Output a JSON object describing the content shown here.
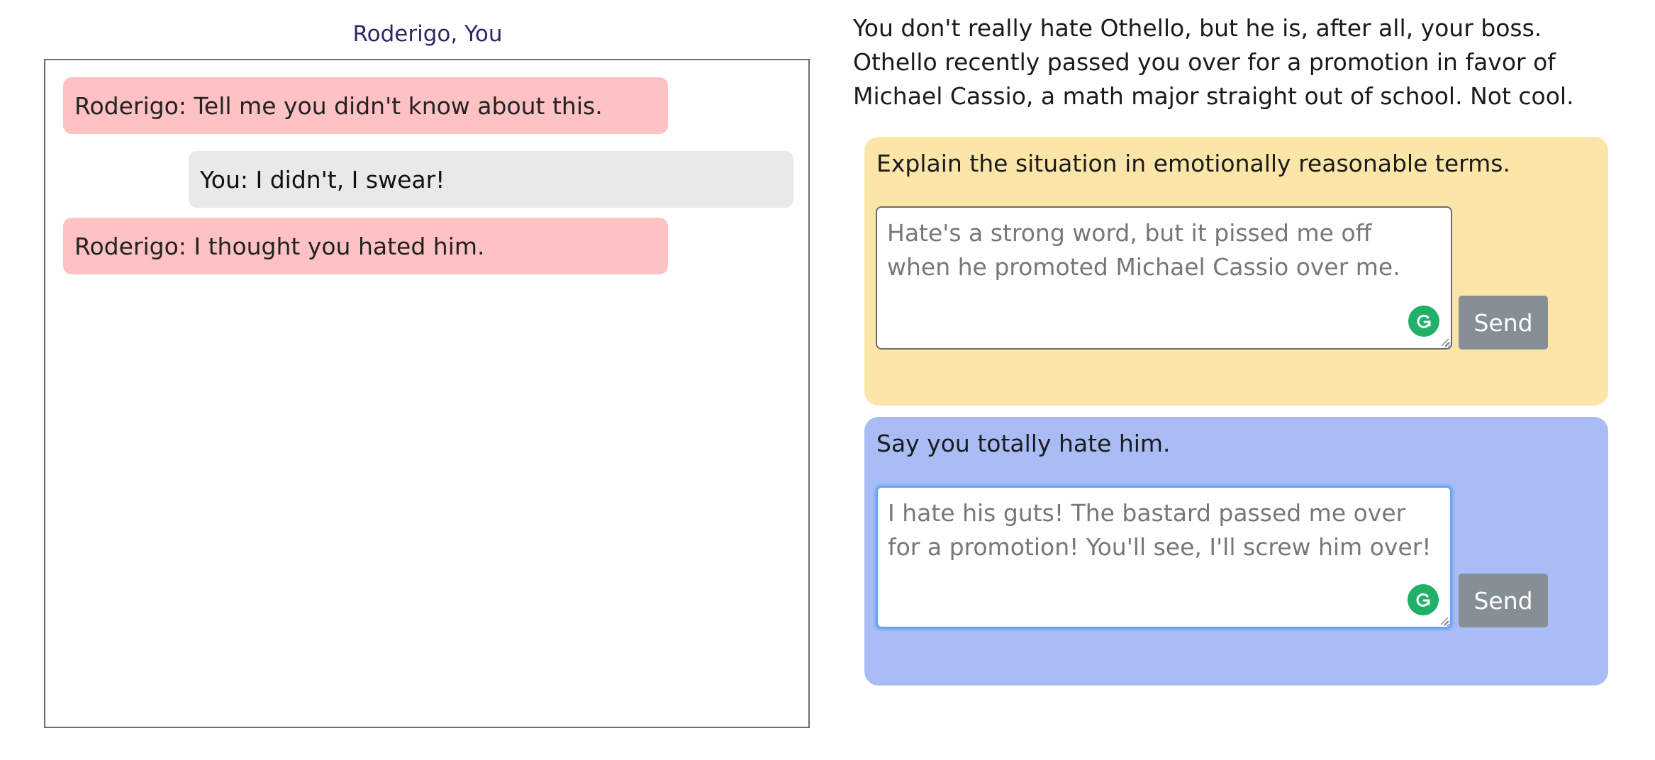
{
  "chat": {
    "header": "Roderigo, You",
    "messages": [
      {
        "speaker": "them",
        "text": "Roderigo: Tell me you didn't know about this."
      },
      {
        "speaker": "you",
        "text": "You: I didn't, I swear!"
      },
      {
        "speaker": "them",
        "text": "Roderigo: I thought you hated him."
      }
    ]
  },
  "scenario": {
    "text": "You don't really hate Othello, but he is, after all, your boss. Othello recently passed you over for a promotion in favor of Michael Cassio, a math major straight out of school. Not cool."
  },
  "options": [
    {
      "color": "#fbe5a9",
      "prompt": "Explain the situation in emotionally reasonable terms.",
      "reply": "Hate's a strong word, but it pissed me off when he promoted Michael Cassio over me.",
      "send_label": "Send",
      "focused": false
    },
    {
      "color": "#a9bcf5",
      "prompt": "Say you totally hate him.",
      "reply": "I hate his guts! The bastard passed me over for a promotion! You'll see, I'll screw him over!",
      "send_label": "Send",
      "focused": true
    }
  ],
  "icons": {
    "grammar": "grammarly-icon",
    "resize": "resize-grip-icon"
  },
  "colors": {
    "them_bubble": "#ffc2c4",
    "you_bubble": "#e9e9e9",
    "send_button": "#868e96",
    "header_text": "#2b2a66"
  }
}
